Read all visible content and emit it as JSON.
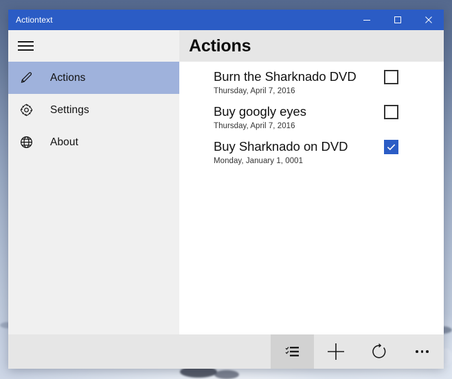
{
  "window": {
    "title": "Actiontext",
    "accent_color": "#2b5cc5",
    "titlebar_controls": [
      {
        "name": "minimize",
        "glyph": "minimize-icon"
      },
      {
        "name": "maximize",
        "glyph": "maximize-icon"
      },
      {
        "name": "close",
        "glyph": "close-icon"
      }
    ]
  },
  "sidebar": {
    "menu_icon": "hamburger-icon",
    "selected_highlight_color": "#9fb2dc",
    "items": [
      {
        "label": "Actions",
        "icon": "pencil-icon",
        "selected": true
      },
      {
        "label": "Settings",
        "icon": "gear-icon",
        "selected": false
      },
      {
        "label": "About",
        "icon": "globe-icon",
        "selected": false
      }
    ]
  },
  "content": {
    "header_title": "Actions",
    "items": [
      {
        "title": "Burn the Sharknado DVD",
        "date": "Thursday, April 7, 2016",
        "checked": false
      },
      {
        "title": "Buy googly eyes",
        "date": "Thursday, April 7, 2016",
        "checked": false
      },
      {
        "title": "Buy Sharknado on DVD",
        "date": "Monday, January 1, 0001",
        "checked": true
      }
    ]
  },
  "appbar": {
    "buttons": [
      {
        "name": "select-list",
        "icon": "checklist-icon",
        "active": true
      },
      {
        "name": "add",
        "icon": "plus-icon",
        "active": false
      },
      {
        "name": "refresh",
        "icon": "refresh-icon",
        "active": false
      },
      {
        "name": "more",
        "icon": "ellipsis-icon",
        "active": false
      }
    ]
  }
}
